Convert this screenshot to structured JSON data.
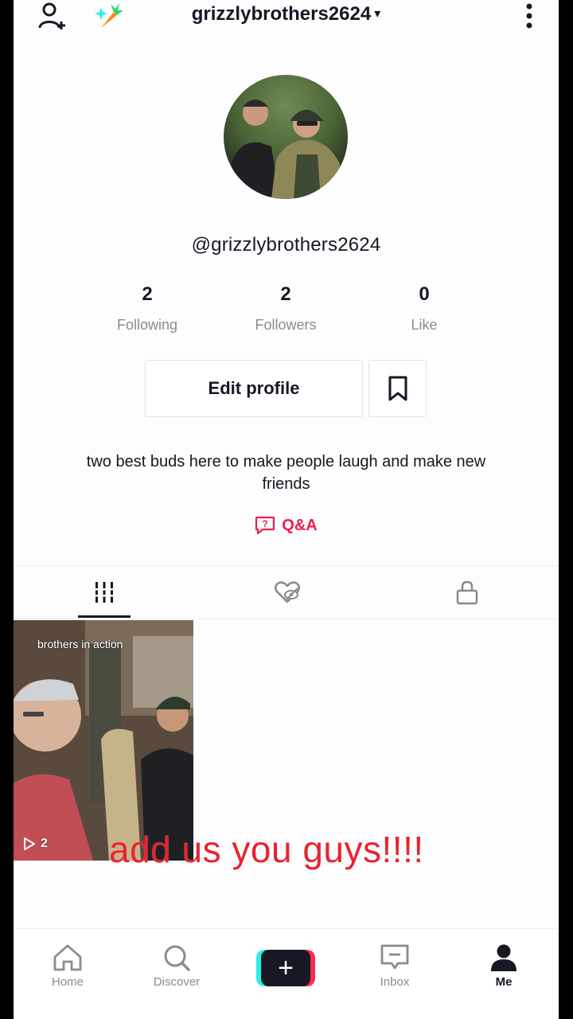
{
  "header": {
    "username": "grizzlybrothers2624",
    "caret": "▾"
  },
  "profile": {
    "handle": "@grizzlybrothers2624",
    "stats": [
      {
        "value": "2",
        "label": "Following"
      },
      {
        "value": "2",
        "label": "Followers"
      },
      {
        "value": "0",
        "label": "Like"
      }
    ],
    "edit_label": "Edit profile",
    "bio": "two best buds here to make people laugh and make new friends",
    "qa_label": "Q&A"
  },
  "videos": [
    {
      "caption": "brothers in action",
      "views": "2"
    }
  ],
  "overlay_text": "add us you guys!!!!",
  "nav": {
    "home": "Home",
    "discover": "Discover",
    "create": "+",
    "inbox": "Inbox",
    "me": "Me"
  },
  "colors": {
    "accent": "#ee1d52",
    "overlay": "#e8242f",
    "text": "#161823",
    "muted": "#8a8b91"
  },
  "icons": [
    "add-friend-icon",
    "carrot-icon",
    "more-icon",
    "bookmark-icon",
    "qa-icon",
    "grid-icon",
    "liked-icon",
    "lock-icon",
    "home-icon",
    "discover-icon",
    "inbox-icon",
    "me-icon",
    "play-icon"
  ]
}
